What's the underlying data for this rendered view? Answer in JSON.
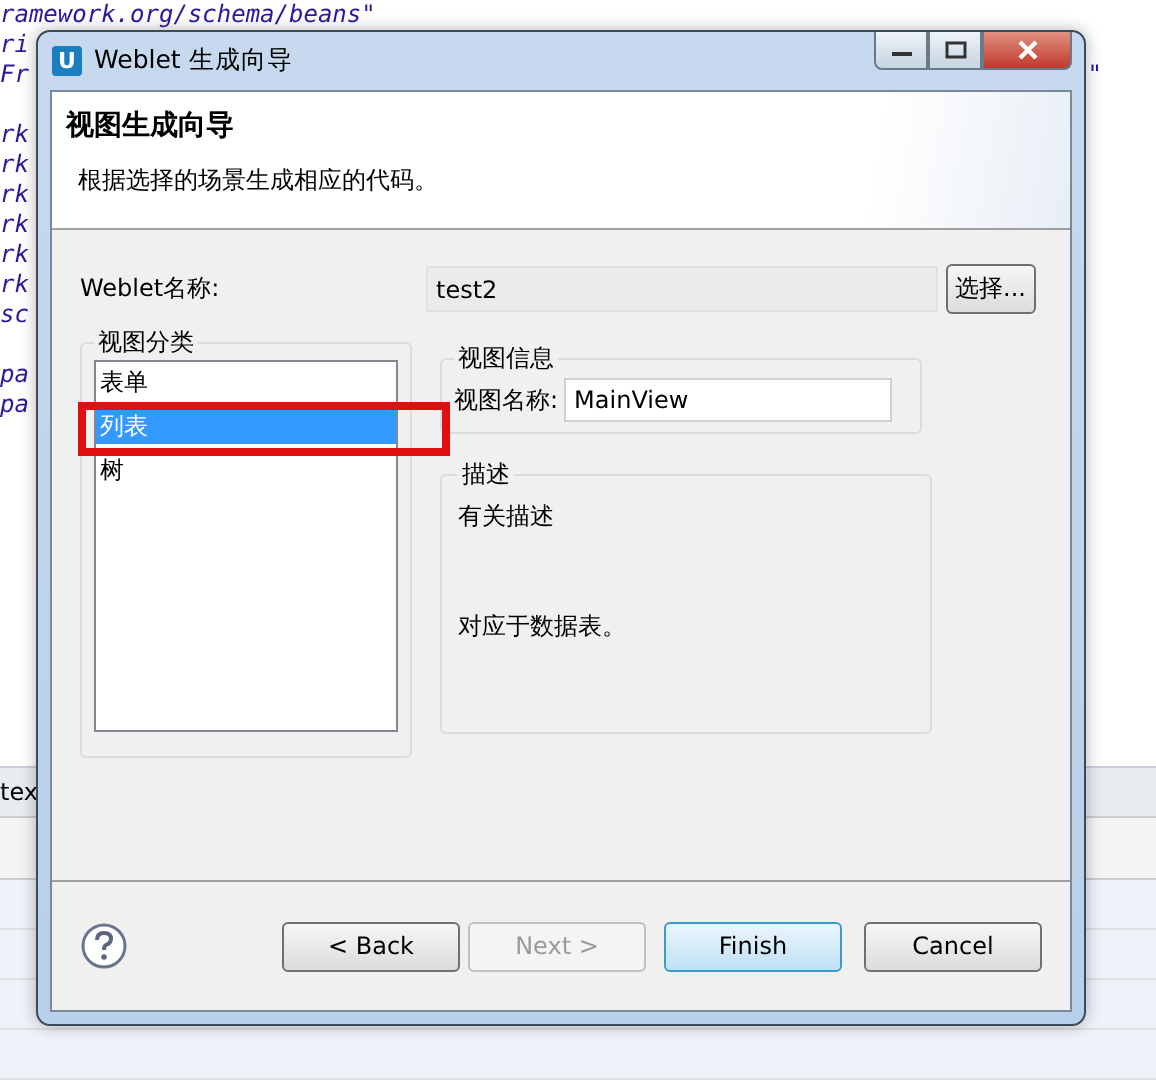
{
  "editor_blocks": [
    [
      {
        "left": "ramework.org/schema/beans\""
      },
      {
        "left": "ri"
      },
      {
        "left": "Fr",
        "right": "\""
      }
    ],
    [
      {
        "left": "rk"
      },
      {
        "left": "rk"
      },
      {
        "left": "rk"
      },
      {
        "left": "rk"
      },
      {
        "left": "rk"
      },
      {
        "left": "rk"
      },
      {
        "left": "sc"
      }
    ],
    [
      {
        "left": "pa"
      },
      {
        "left": "pa"
      }
    ]
  ],
  "editor_tab": "tex",
  "window": {
    "icon_letter": "U",
    "title": "Weblet 生成向导"
  },
  "header": {
    "title": "视图生成向导",
    "description": "根据选择的场景生成相应的代码。"
  },
  "weblet_name": {
    "label": "Weblet名称:",
    "value": "test2",
    "button": "选择..."
  },
  "categories": {
    "title": "视图分类",
    "items": [
      {
        "label": "表单",
        "selected": false
      },
      {
        "label": "列表",
        "selected": true
      },
      {
        "label": "树",
        "selected": false
      }
    ]
  },
  "view_info": {
    "title": "视图信息",
    "label": "视图名称:",
    "value": "MainView"
  },
  "description": {
    "title": "描述",
    "lines": [
      "有关描述",
      "对应于数据表。"
    ]
  },
  "buttons": [
    {
      "label": "< Back",
      "disabled": false,
      "default": false
    },
    {
      "label": "Next >",
      "disabled": true,
      "default": false
    },
    {
      "label": "Finish",
      "disabled": false,
      "default": true
    },
    {
      "label": "Cancel",
      "disabled": false,
      "default": false
    }
  ]
}
